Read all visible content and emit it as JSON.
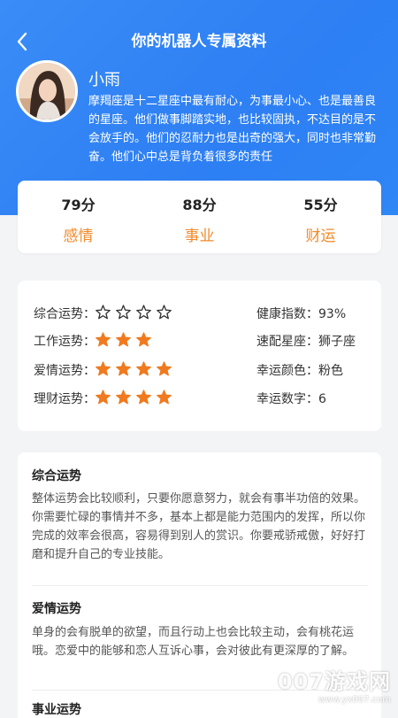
{
  "nav": {
    "title": "你的机器人专属资料",
    "back_icon": "chevron-left-icon"
  },
  "profile": {
    "name": "小雨",
    "description": "摩羯座是十二星座中最有耐心，为事最小心、也是最善良的星座。他们做事脚踏实地，也比较固执，不达目的是不会放手的。他们的忍耐力也是出奇的强大，同时也非常勤奋。他们心中总是背负着很多的责任"
  },
  "scores": [
    {
      "value": "79分",
      "label": "感情"
    },
    {
      "value": "88分",
      "label": "事业"
    },
    {
      "value": "55分",
      "label": "财运"
    }
  ],
  "fortune": {
    "rows": [
      {
        "label": "综合运势：",
        "stars": 0,
        "total": 4,
        "right": "健康指数：93%"
      },
      {
        "label": "工作运势：",
        "stars": 3,
        "total": 3,
        "right": "速配星座：狮子座"
      },
      {
        "label": "爱情运势：",
        "stars": 4,
        "total": 4,
        "right": "幸运颜色：粉色"
      },
      {
        "label": "理财运势：",
        "stars": 4,
        "total": 4,
        "right": "幸运数字：6"
      }
    ]
  },
  "details": [
    {
      "title": "综合运势",
      "body": "整体运势会比较顺利，只要你愿意努力，就会有事半功倍的效果。你需要忙碌的事情并不多，基本上都是能力范围内的发挥，所以你完成的效率会很高，容易得到别人的赏识。你要戒骄戒傲，好好打磨和提升自己的专业技能。"
    },
    {
      "title": "爱情运势",
      "body": "单身的会有脱单的欲望，而且行动上也会比较主动，会有桃花运哦。恋爱中的能够和恋人互诉心事，会对彼此有更深厚的了解。"
    },
    {
      "title": "事业运势",
      "body": ""
    }
  ],
  "colors": {
    "primary": "#2f86f5",
    "accent": "#f08a2a",
    "star": "#f07a1f"
  },
  "watermark": {
    "main": "007游戏网",
    "url": "www.yx007.com"
  }
}
